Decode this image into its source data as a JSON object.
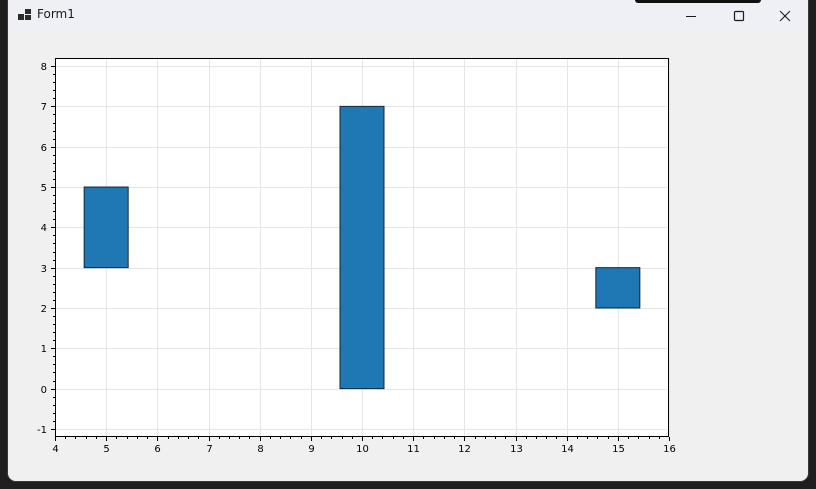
{
  "window": {
    "title": "Form1",
    "buttons": {
      "minimize": "minimize-icon",
      "maximize": "maximize-icon",
      "close": "close-icon"
    }
  },
  "colors": {
    "bar_fill": "#1f77b4",
    "bar_stroke": "#0a2a40",
    "grid": "#e6e6e6",
    "axis": "#000000"
  },
  "chart_data": {
    "type": "bar",
    "title": "",
    "xlabel": "",
    "ylabel": "",
    "xlim": [
      4,
      16
    ],
    "ylim": [
      -1.2,
      8.2
    ],
    "grid": true,
    "x_ticks": [
      4,
      5,
      6,
      7,
      8,
      9,
      10,
      11,
      12,
      13,
      14,
      15,
      16
    ],
    "y_ticks": [
      -1,
      0,
      1,
      2,
      3,
      4,
      5,
      6,
      7,
      8
    ],
    "bars": [
      {
        "x_start": 4.57,
        "x_end": 5.43,
        "y_bottom": 3,
        "y_top": 5
      },
      {
        "x_start": 9.57,
        "x_end": 10.43,
        "y_bottom": 0,
        "y_top": 7
      },
      {
        "x_start": 14.57,
        "x_end": 15.43,
        "y_bottom": 2,
        "y_top": 3
      }
    ]
  }
}
